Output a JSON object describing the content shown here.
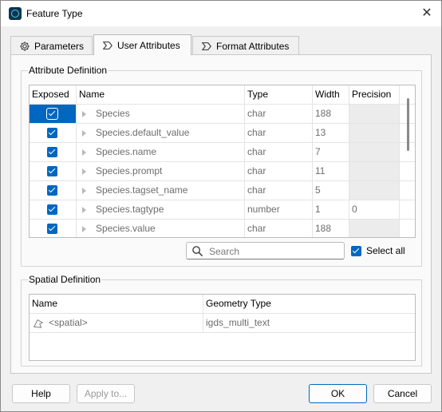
{
  "window": {
    "title": "Feature Type",
    "close_glyph": "✕"
  },
  "tabs": [
    {
      "label": "Parameters",
      "icon": "gear-icon"
    },
    {
      "label": "User Attributes",
      "icon": "tag-icon"
    },
    {
      "label": "Format Attributes",
      "icon": "tag-icon"
    }
  ],
  "attribute_definition": {
    "title": "Attribute Definition",
    "columns": [
      "Exposed",
      "Name",
      "Type",
      "Width",
      "Precision"
    ],
    "rows": [
      {
        "exposed": true,
        "name": "Species",
        "type": "char",
        "width": "188",
        "precision": ""
      },
      {
        "exposed": true,
        "name": "Species.default_value",
        "type": "char",
        "width": "13",
        "precision": ""
      },
      {
        "exposed": true,
        "name": "Species.name",
        "type": "char",
        "width": "7",
        "precision": ""
      },
      {
        "exposed": true,
        "name": "Species.prompt",
        "type": "char",
        "width": "11",
        "precision": ""
      },
      {
        "exposed": true,
        "name": "Species.tagset_name",
        "type": "char",
        "width": "5",
        "precision": ""
      },
      {
        "exposed": true,
        "name": "Species.tagtype",
        "type": "number",
        "width": "1",
        "precision": "0"
      },
      {
        "exposed": true,
        "name": "Species.value",
        "type": "char",
        "width": "188",
        "precision": ""
      }
    ],
    "search_placeholder": "Search",
    "select_all_label": "Select all",
    "select_all_checked": true
  },
  "spatial_definition": {
    "title": "Spatial Definition",
    "columns": [
      "Name",
      "Geometry Type"
    ],
    "rows": [
      {
        "name": "<spatial>",
        "geometry_type": "igds_multi_text"
      }
    ]
  },
  "buttons": {
    "help": "Help",
    "apply_to": "Apply to...",
    "ok": "OK",
    "cancel": "Cancel"
  },
  "colors": {
    "accent": "#0067c0"
  }
}
